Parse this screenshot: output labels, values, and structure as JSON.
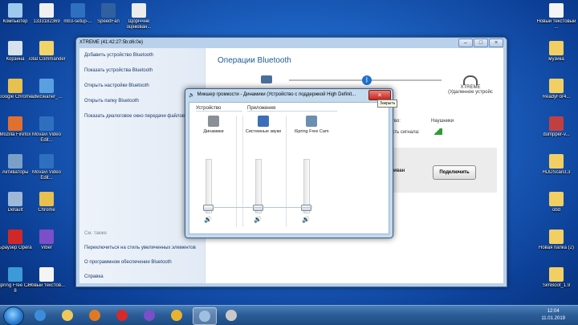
{
  "desktop": {
    "icons_left": [
      {
        "label": "Компьютер",
        "color": "#9ec9ef"
      },
      {
        "label": "Корзина",
        "color": "#d8e2ec"
      },
      {
        "label": "Google Chrome",
        "color": "#e8c050"
      },
      {
        "label": "Mozilla Firefox",
        "color": "#e07030"
      },
      {
        "label": "Активаторы",
        "color": "#7c9fc7"
      },
      {
        "label": "Default",
        "color": "#9fb8d6"
      },
      {
        "label": "Браузер Opera",
        "color": "#d02828"
      },
      {
        "label": "iSpring Free Cam 8",
        "color": "#3c9ad8"
      }
    ],
    "icons_col2": [
      {
        "label": "1333182369",
        "color": "#f0f0f0"
      },
      {
        "label": "Total Commander",
        "color": "#f2d36a"
      },
      {
        "label": "adwcleaner_...",
        "color": "#5aa0e0"
      },
      {
        "label": "Movavi Video Edit...",
        "color": "#2f6fbf"
      },
      {
        "label": "Movavi Video Edit...",
        "color": "#2f6fbf"
      },
      {
        "label": "Chrome",
        "color": "#e8c050"
      },
      {
        "label": "Viber",
        "color": "#7a4fc8"
      },
      {
        "label": "Новый текстов...",
        "color": "#f4f4f4"
      }
    ],
    "icons_top": [
      {
        "label": "mb3-setup-...",
        "color": "#2f6fbf"
      },
      {
        "label": "SpeedFan",
        "color": "#3060a0"
      },
      {
        "label": "Щоріччне оцінюван...",
        "color": "#ececec"
      }
    ],
    "icons_right": [
      {
        "label": "Новый текстовый ...",
        "color": "#f4f4f4"
      },
      {
        "label": "музика",
        "color": "#f2cf63"
      },
      {
        "label": "ReadyFor4...",
        "color": "#f2cf63"
      },
      {
        "label": "dumpper-v...",
        "color": "#c04040"
      },
      {
        "label": "HDDScan3.3",
        "color": "#f2cf63"
      },
      {
        "label": "obd",
        "color": "#f2cf63"
      },
      {
        "label": "Новая папка (2)",
        "color": "#f2cf63"
      },
      {
        "label": "SimBoot_1.9",
        "color": "#f2cf63"
      }
    ]
  },
  "bt_window": {
    "title": "XTREME (41:42:27:5b:d6:0e)",
    "tasks": [
      "Добавить устройство Bluetooth",
      "Показать устройства Bluetooth",
      "Открыть настройки Bluetooth",
      "Открыть папку Bluetooth",
      "Показать диалоговое окно передачи файлов"
    ],
    "see_also_header": "См. также",
    "see_also": [
      "Переключиться на стиль увеличенных элементов",
      "О программном обеспечении Bluetooth",
      "Справка"
    ],
    "panel_title": "Операции Bluetooth",
    "device_name": "XTREME",
    "device_state": "(Удаленное устройс",
    "service_label": "ство:",
    "service_value": "Наушники",
    "signal_label": "ость сигнала:",
    "row_label": "шиван",
    "connect_button": "Подключить"
  },
  "mixer": {
    "title": "Микшер громкости - Динамики (Устройство с поддержкой High Definit...",
    "close_tooltip": "Закрыть",
    "device_header": "Устройство",
    "apps_header": "Приложения",
    "channels": [
      {
        "name": "Динамики",
        "level": 0.05
      },
      {
        "name": "Системные звуки",
        "level": 0.05
      },
      {
        "name": "iSpring Free Cam",
        "level": 0.05
      }
    ]
  },
  "taskbar": {
    "time": "12:04",
    "date": "11.01.2019",
    "apps": [
      "ie",
      "explorer",
      "media-player",
      "opera",
      "viber",
      "chrome",
      "bluetooth",
      "stop"
    ]
  }
}
